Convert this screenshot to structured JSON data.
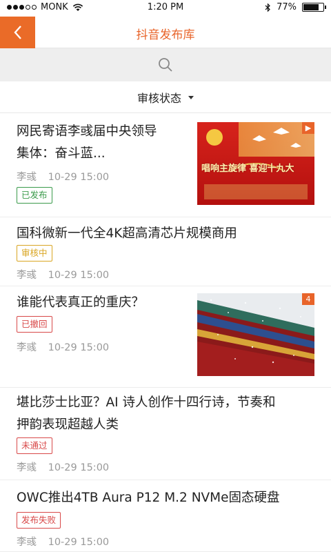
{
  "status_bar": {
    "carrier": "MONK",
    "time": "1:20 PM",
    "battery": "77%",
    "battery_level": 0.77
  },
  "header": {
    "title": "抖音发布库",
    "back_icon": "chevron-left-icon"
  },
  "search": {
    "icon": "search-icon"
  },
  "filter": {
    "label": "审核状态"
  },
  "colors": {
    "accent": "#ea6b28",
    "published": "#3a9a4a",
    "reviewing": "#d9a521",
    "withdrawn": "#d84848",
    "rejected": "#d84848",
    "failed": "#d84848"
  },
  "articles": [
    {
      "title_line1": "网民寄语李彧届中央领导",
      "title_line2": "集体：奋斗蓝...",
      "author": "李彧",
      "date": "10-29",
      "time": "15:00",
      "status": "已发布",
      "thumb_badge": "▶",
      "thumb_text": "唱响主旋律 喜迎十九大"
    },
    {
      "title_line1": "国科微新一代全4K超高清芯片规模商用",
      "author": "李彧",
      "date": "10-29",
      "time": "15:00",
      "status": "审核中"
    },
    {
      "title_line1": "谁能代表真正的重庆？",
      "author": "李彧",
      "date": "10-29",
      "time": "15:00",
      "status": "已撤回",
      "thumb_badge": "4"
    },
    {
      "title_line1": "堪比莎士比亚？AI 诗人创作十四行诗，节奏和",
      "title_line2": "押韵表现超越人类",
      "author": "李彧",
      "date": "10-29",
      "time": "15:00",
      "status": "未通过"
    },
    {
      "title_line1": "OWC推出4TB Aura P12 M.2 NVMe固态硬盘",
      "author": "李彧",
      "date": "10-29",
      "time": "15:00",
      "status": "发布失败"
    }
  ]
}
